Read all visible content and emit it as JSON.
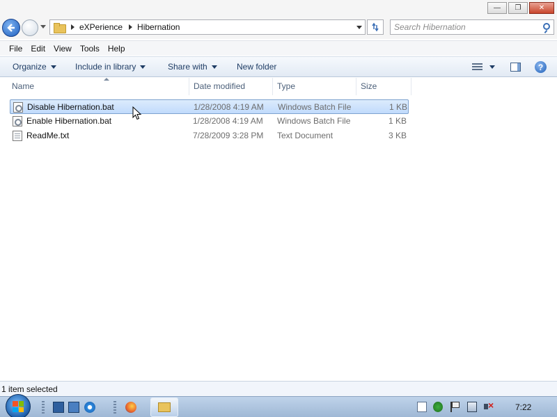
{
  "window": {
    "minimize_label": "—",
    "maximize_label": "❐",
    "close_label": "✕"
  },
  "address": {
    "crumbs": [
      "eXPerience",
      "Hibernation"
    ],
    "search_placeholder": "Search Hibernation"
  },
  "menubar": {
    "items": [
      "File",
      "Edit",
      "View",
      "Tools",
      "Help"
    ]
  },
  "commandbar": {
    "organize": "Organize",
    "include_in_library": "Include in library",
    "share_with": "Share with",
    "new_folder": "New folder",
    "help_glyph": "?"
  },
  "filelist": {
    "columns": {
      "name": "Name",
      "date_modified": "Date modified",
      "type": "Type",
      "size": "Size"
    },
    "files": [
      {
        "name": "Disable Hibernation.bat",
        "date": "1/28/2008 4:19 AM",
        "type": "Windows Batch File",
        "size": "1 KB",
        "icon": "batch-file-icon",
        "selected": true
      },
      {
        "name": "Enable Hibernation.bat",
        "date": "1/28/2008 4:19 AM",
        "type": "Windows Batch File",
        "size": "1 KB",
        "icon": "batch-file-icon",
        "selected": false
      },
      {
        "name": "ReadMe.txt",
        "date": "7/28/2009 3:28 PM",
        "type": "Text Document",
        "size": "3 KB",
        "icon": "text-file-icon",
        "selected": false
      }
    ]
  },
  "status": {
    "text": "1 item selected"
  },
  "taskbar": {
    "clock": "7:22"
  },
  "colors": {
    "selection": "#c1dbfc",
    "command_text": "#1e3c64",
    "taskbar": "#bfd3ea"
  }
}
